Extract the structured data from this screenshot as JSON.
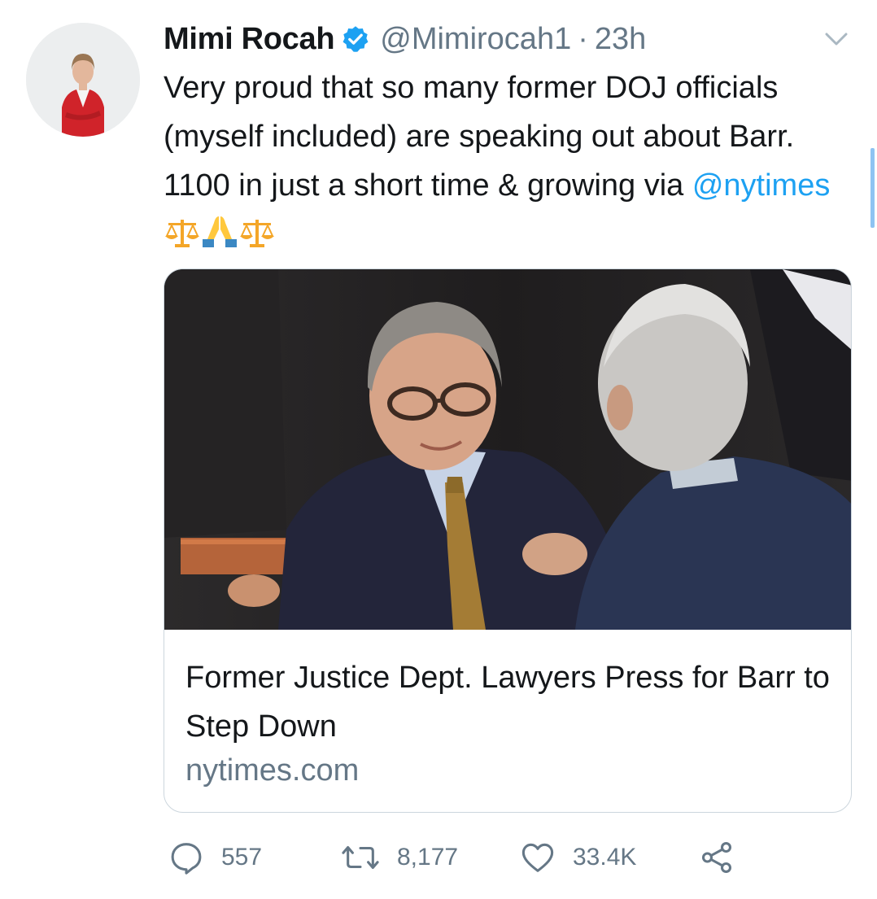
{
  "tweet": {
    "author_name": "Mimi Rocah",
    "handle": "@Mimirocah1",
    "separator": "·",
    "time": "23h",
    "text_before": "Very proud that so many former DOJ officials (myself included) are speaking out about Barr. 1100 in just a short time & growing via ",
    "mention": "@nytimes",
    "emoji": [
      "scales-icon",
      "folded-hands-icon",
      "scales-icon"
    ]
  },
  "card": {
    "title": "Former Justice Dept. Lawyers Press for Barr to Step Down",
    "domain": "nytimes.com"
  },
  "actions": {
    "replies": "557",
    "retweets": "8,177",
    "likes": "33.4K"
  },
  "colors": {
    "accent": "#1da1f2",
    "secondary_text": "#657786",
    "border": "#ccd6dd"
  }
}
